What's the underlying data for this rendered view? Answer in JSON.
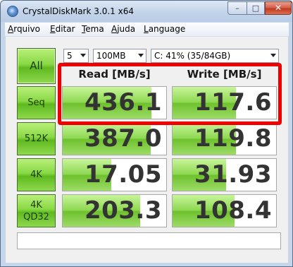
{
  "window": {
    "title": "CrystalDiskMark 3.0.1 x64",
    "minimize_glyph": "–",
    "maximize_glyph": "□",
    "close_glyph": "✕"
  },
  "menu": {
    "items": [
      {
        "pre": "",
        "key": "A",
        "rest": "rquivo"
      },
      {
        "pre": "",
        "key": "E",
        "rest": "ditar"
      },
      {
        "pre": "",
        "key": "T",
        "rest": "ema"
      },
      {
        "pre": "",
        "key": "A",
        "rest": "juda"
      },
      {
        "pre": "",
        "key": "L",
        "rest": "anguage"
      }
    ]
  },
  "controls": {
    "all_label": "All",
    "runs": "5",
    "size": "100MB",
    "drive": "C: 41% (35/84GB)"
  },
  "columns": {
    "read": "Read [MB/s]",
    "write": "Write [MB/s]"
  },
  "tests": [
    {
      "label": "Seq",
      "label2": "",
      "read": "436.1",
      "write": "117.6",
      "read_fill": 0.86,
      "write_fill": 0.61
    },
    {
      "label": "512K",
      "label2": "",
      "read": "387.0",
      "write": "119.8",
      "read_fill": 0.85,
      "write_fill": 0.61
    },
    {
      "label": "4K",
      "label2": "",
      "read": "17.05",
      "write": "31.93",
      "read_fill": 0.47,
      "write_fill": 0.52
    },
    {
      "label": "4K",
      "label2": "QD32",
      "read": "203.3",
      "write": "108.4",
      "read_fill": 0.75,
      "write_fill": 0.6
    }
  ],
  "colors": {
    "accent_green": "#7cc93a",
    "highlight_red": "#ee0000"
  },
  "comment": ""
}
